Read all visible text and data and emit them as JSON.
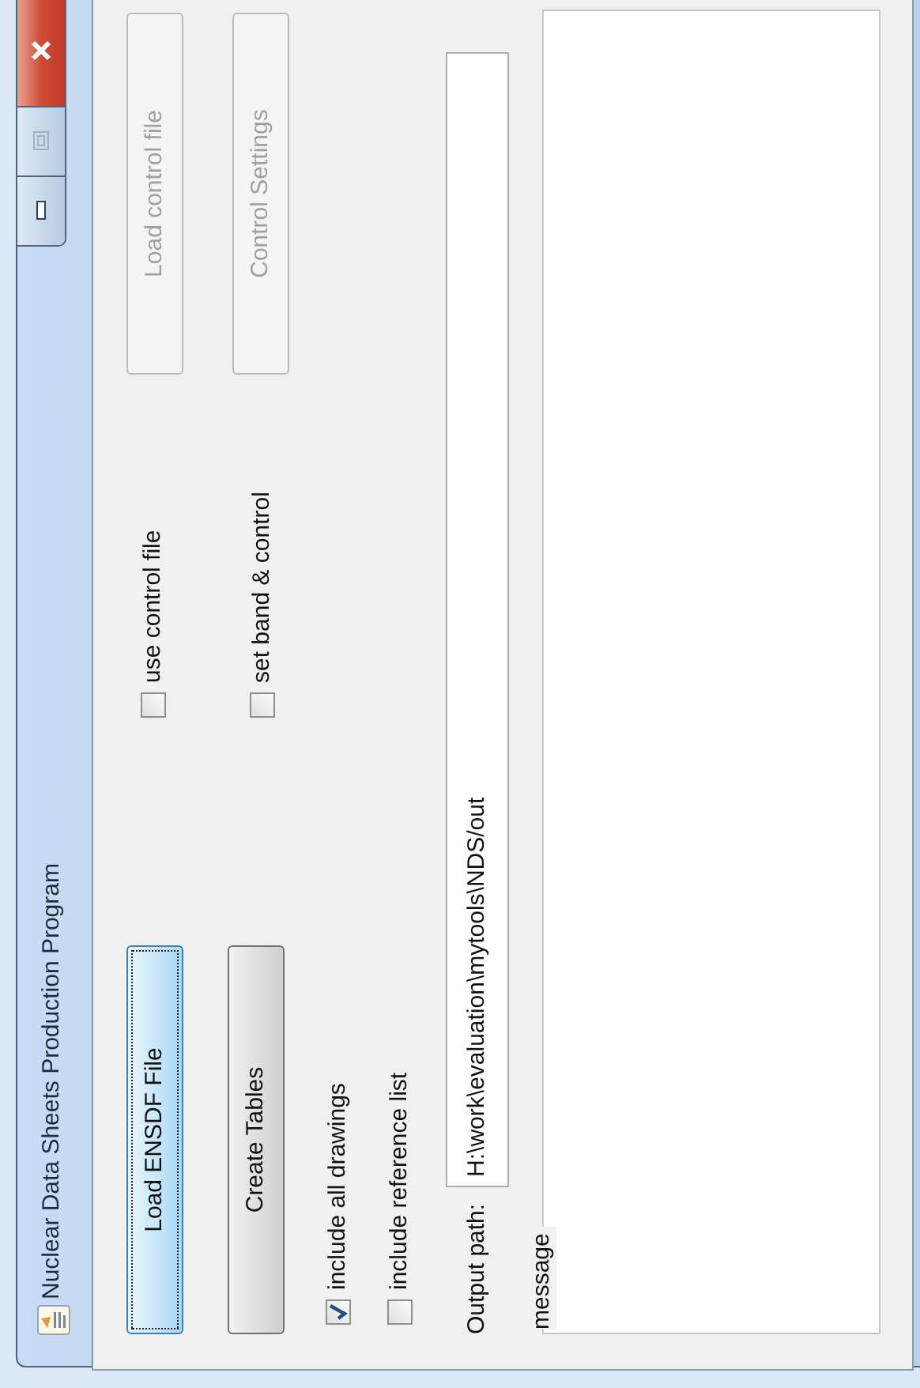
{
  "window": {
    "title": "Nuclear Data Sheets Production Program"
  },
  "main_buttons": [
    {
      "label": "Load ENSDF File",
      "focused": true,
      "disabled": false
    },
    {
      "label": "Create Tables",
      "focused": false,
      "disabled": false
    }
  ],
  "control_options": [
    {
      "label": "use control file",
      "checked": false
    },
    {
      "label": "set band & control",
      "checked": false
    }
  ],
  "control_buttons": [
    {
      "label": "Load control file",
      "focused": false,
      "disabled": true
    },
    {
      "label": "Control Settings",
      "focused": false,
      "disabled": true
    }
  ],
  "include_options": [
    {
      "label": "include all drawings",
      "checked": true
    },
    {
      "label": "include reference list",
      "checked": false
    }
  ],
  "output_path": {
    "label": "Output path:",
    "value": "H:\\work\\evaluation\\mytools\\NDS/out"
  },
  "message": {
    "label": "message"
  }
}
